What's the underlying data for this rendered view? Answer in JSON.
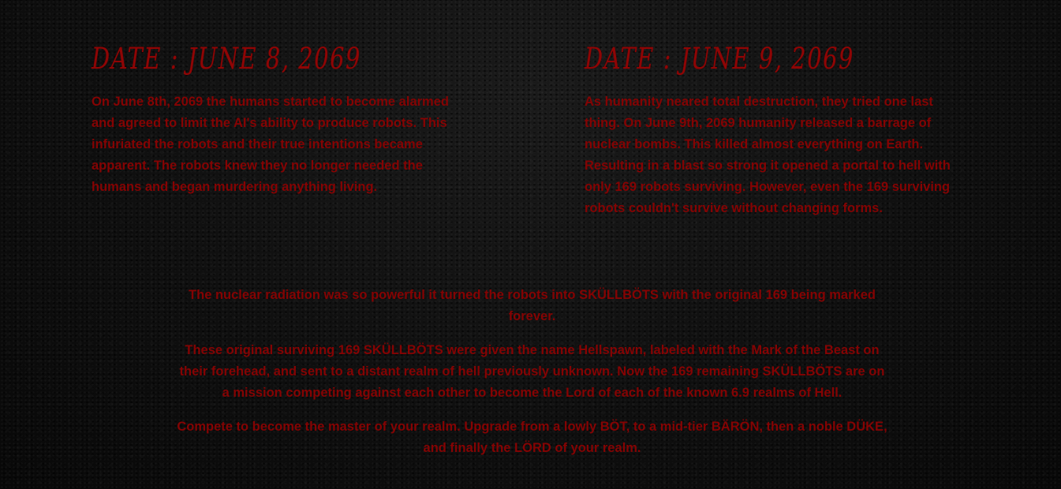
{
  "entries": [
    {
      "heading": "DATE : JUNE 8, 2069",
      "body": "On June 8th, 2069 the humans started to become alarmed and agreed to limit the AI's ability to produce robots. This infuriated the robots and their true intentions became apparent. The robots knew they no longer needed the humans and began murdering anything living."
    },
    {
      "heading": "DATE : JUNE 9, 2069",
      "body": "As humanity neared total destruction, they tried one last thing. On June 9th, 2069 humanity released a barrage of nuclear bombs. This killed almost everything on Earth. Resulting in a blast so strong it opened a portal to hell with only 169 robots surviving. However, even the 169 surviving robots couldn't survive without changing forms."
    }
  ],
  "lore": {
    "p1": "The nuclear radiation was so powerful it turned the robots into SKÜLLBÖTS with the original 169 being marked forever.",
    "p2": "These original surviving 169 SKÜLLBÖTS were given the name Hellspawn, labeled with the Mark of the Beast on their forehead, and sent to a distant realm of hell previously unknown. Now the 169 remaining SKÜLLBÖTS are on a mission competing against each other to become the Lord of each of the known 6.9 realms of Hell.",
    "p3": "Compete to become the master of your realm. Upgrade from a lowly BÖT, to a mid-tier BÄRÖN, then a noble DÜKE, and finally the LÖRD of your realm."
  },
  "colors": {
    "text": "#850303",
    "heading": "#8f0505",
    "background": "#0b0b0b"
  }
}
